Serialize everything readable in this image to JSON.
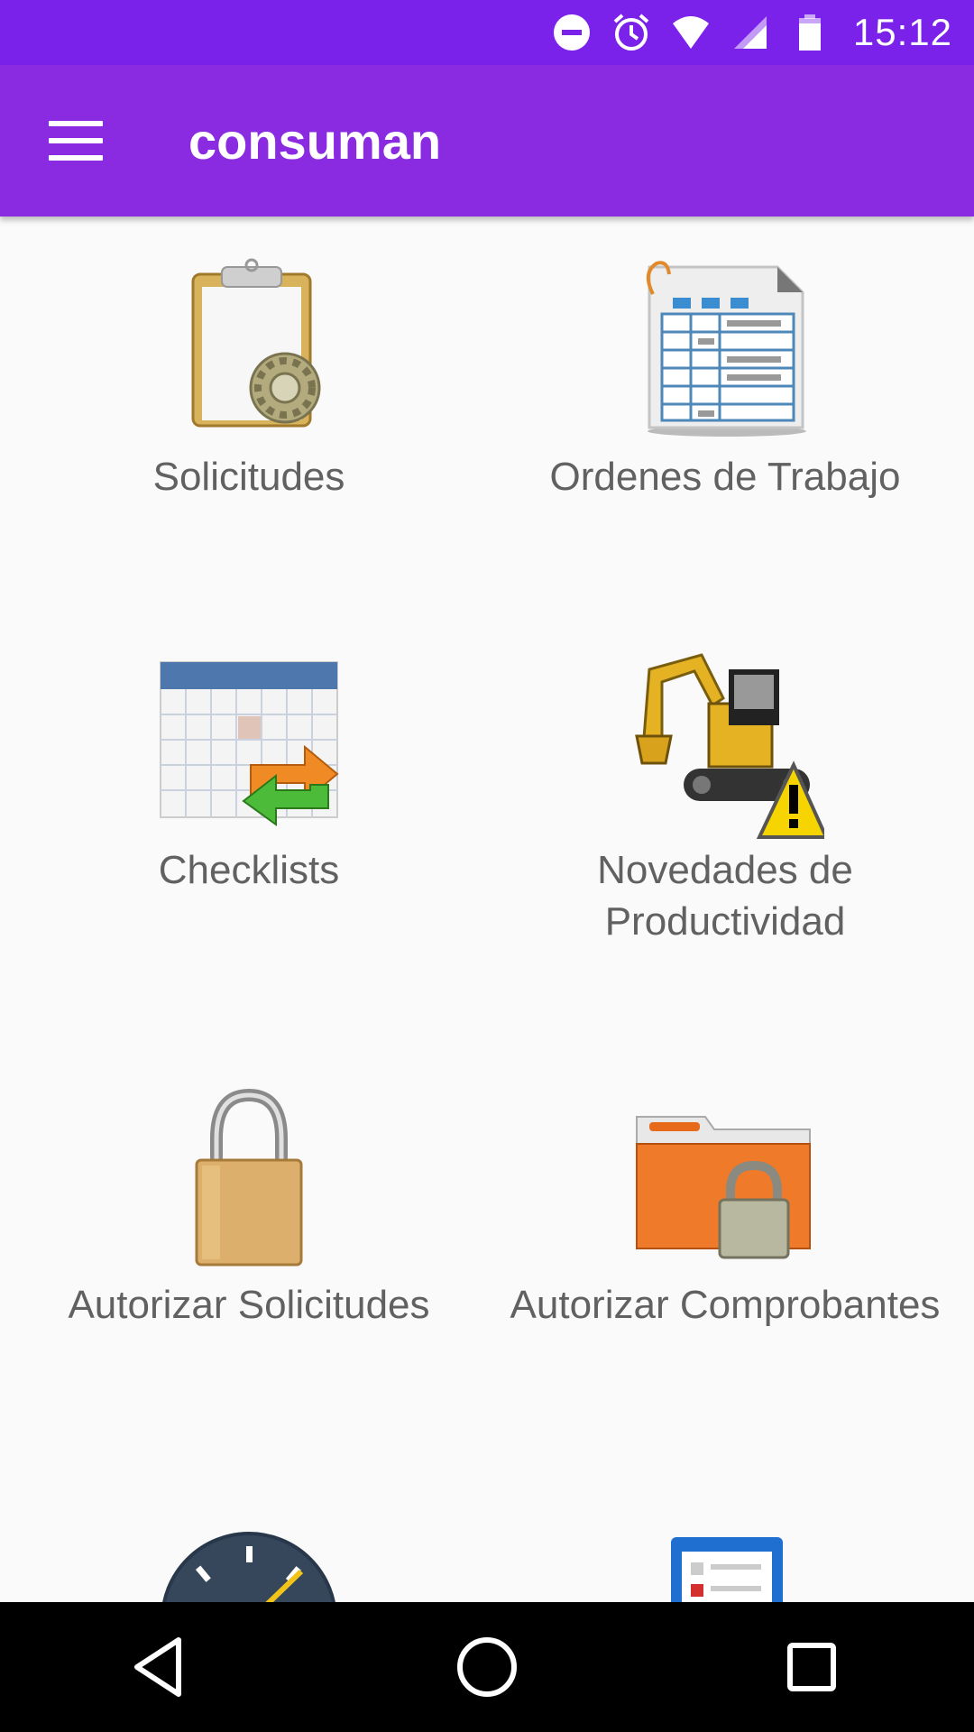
{
  "status_bar": {
    "time": "15:12",
    "icons": [
      "do-not-disturb-icon",
      "alarm-icon",
      "wifi-icon",
      "signal-icon",
      "battery-icon"
    ]
  },
  "app_bar": {
    "title": "consuman",
    "menu_icon": "menu-icon"
  },
  "tiles": [
    {
      "label": "Solicitudes",
      "icon": "clipboard-gear-icon"
    },
    {
      "label": "Ordenes de Trabajo",
      "icon": "spreadsheet-document-icon"
    },
    {
      "label": "Checklists",
      "icon": "calendar-sync-icon"
    },
    {
      "label": "Novedades de Productividad",
      "icon": "excavator-warning-icon"
    },
    {
      "label": "Autorizar Solicitudes",
      "icon": "padlock-icon"
    },
    {
      "label": "Autorizar Comprobantes",
      "icon": "locked-folder-icon"
    },
    {
      "label": "",
      "icon": "speedometer-icon"
    },
    {
      "label": "",
      "icon": "clipboard-list-icon"
    }
  ],
  "nav_bar": {
    "icons": [
      "back-icon",
      "home-icon",
      "recents-icon"
    ]
  },
  "colors": {
    "status_bar": "#7b22ea",
    "app_bar": "#8a2be2",
    "background": "#fafafa",
    "label_text": "#616161"
  }
}
